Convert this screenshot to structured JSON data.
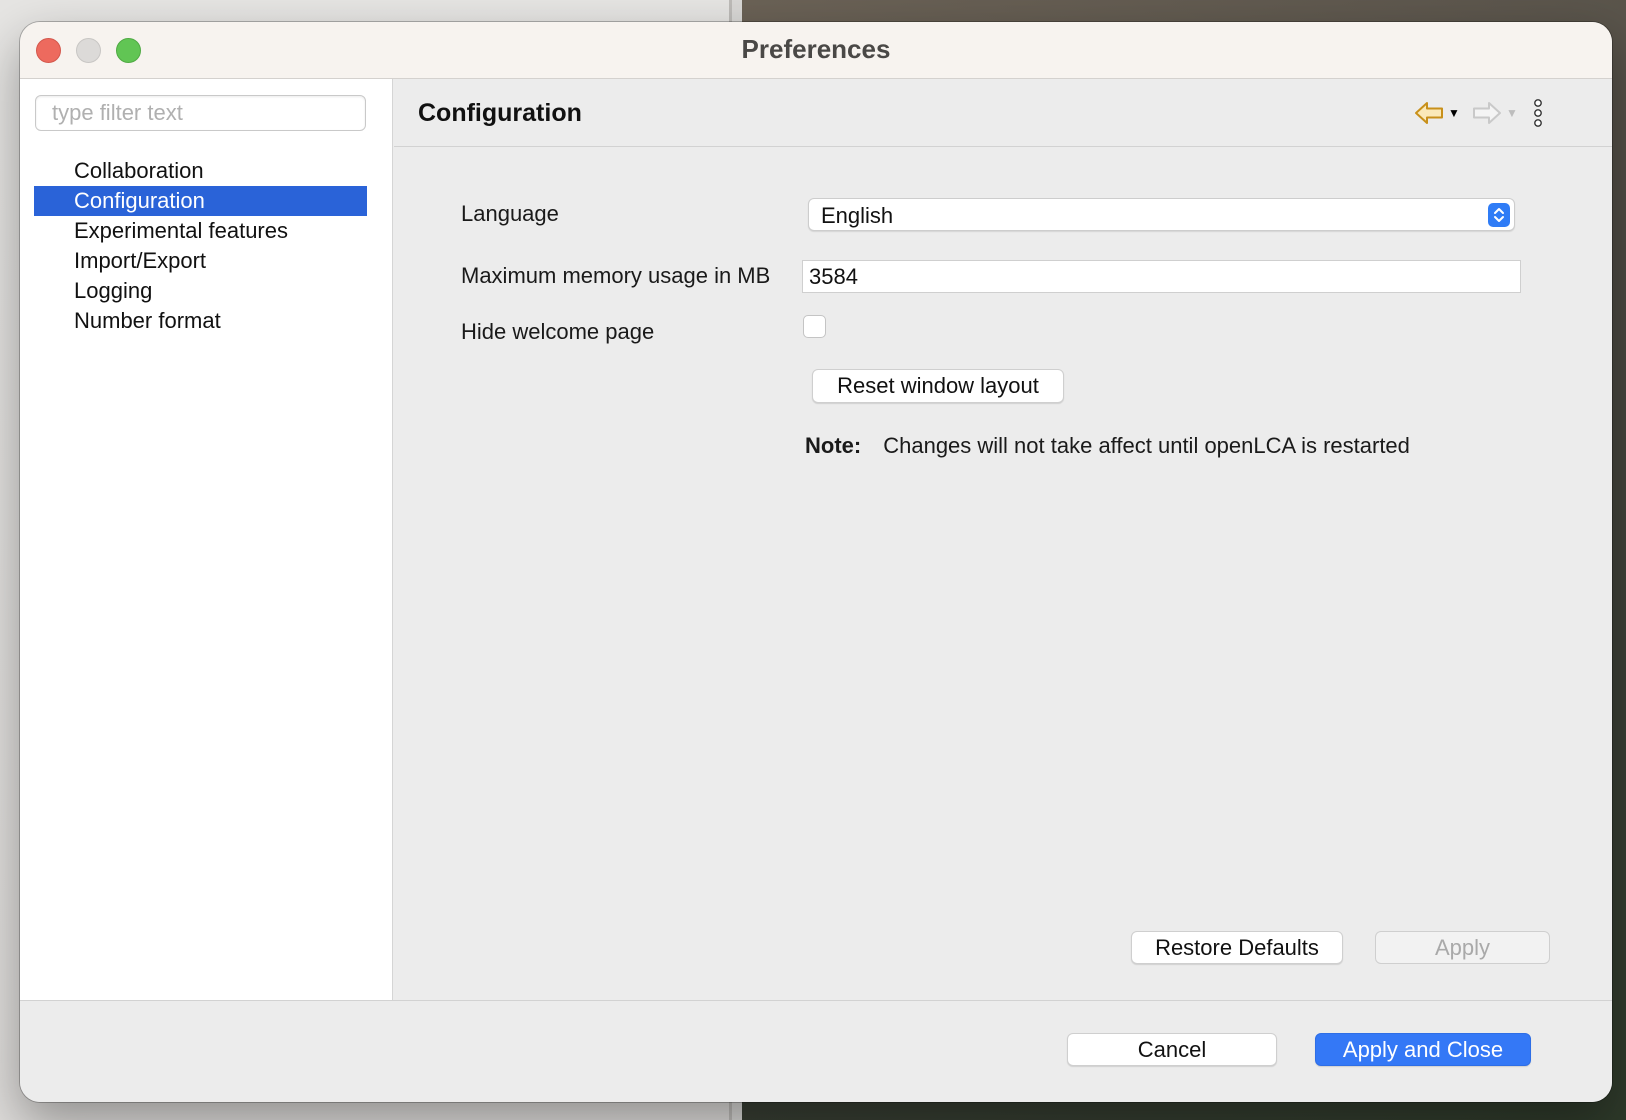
{
  "window": {
    "title": "Preferences"
  },
  "sidebar": {
    "filter_placeholder": "type filter text",
    "items": [
      {
        "label": "Collaboration"
      },
      {
        "label": "Configuration",
        "selected": true
      },
      {
        "label": "Experimental features"
      },
      {
        "label": "Import/Export"
      },
      {
        "label": "Logging"
      },
      {
        "label": "Number format"
      }
    ]
  },
  "page": {
    "title": "Configuration",
    "language_label": "Language",
    "language_value": "English",
    "memory_label": "Maximum memory usage in MB",
    "memory_value": "3584",
    "hide_welcome_label": "Hide welcome page",
    "hide_welcome_checked": false,
    "reset_layout_button": "Reset window layout",
    "note_label": "Note:",
    "note_text": "Changes will not take affect until openLCA is restarted",
    "restore_defaults_button": "Restore Defaults",
    "apply_button": "Apply"
  },
  "footer": {
    "cancel_button": "Cancel",
    "apply_close_button": "Apply and Close"
  },
  "icons": {
    "back": "back-arrow-icon",
    "forward": "forward-arrow-icon",
    "menu": "vertical-dots-menu-icon"
  },
  "colors": {
    "selection": "#2a63d8",
    "primary_button": "#3478f6",
    "back_arrow": "#c8901a",
    "close_button": "#ed6a5e",
    "maximize_button": "#61c554"
  }
}
